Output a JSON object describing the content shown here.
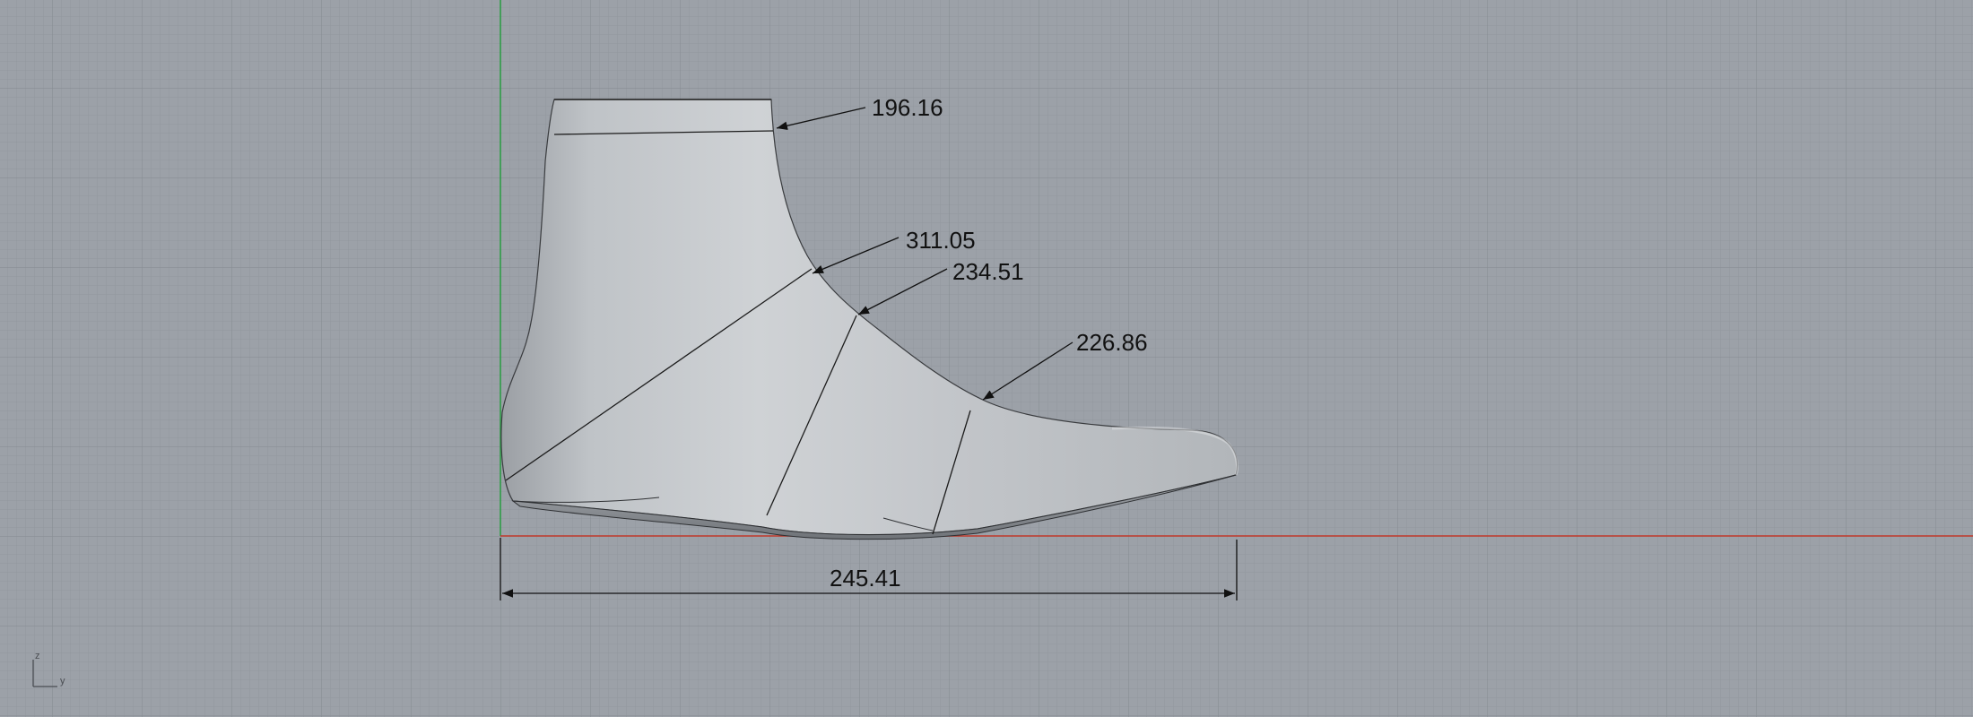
{
  "viewport": {
    "background": "#9ca1a8",
    "minor_grid_color": "#8f949b",
    "major_grid_color": "#868b92",
    "x_axis_color": "#c0392b",
    "z_axis_color": "#2e9d47"
  },
  "model": {
    "surface_light": "#c8cbce",
    "surface_dark": "#8d9196",
    "outline": "#2a2a2a"
  },
  "dimensions": {
    "top_girth": "196.16",
    "instep_girth": "311.05",
    "waist_girth": "234.51",
    "ball_girth": "226.86",
    "overall_length": "245.41"
  },
  "axis_icon": {
    "vertical": "z",
    "horizontal": "y",
    "icon": "axis-triad-icon"
  }
}
